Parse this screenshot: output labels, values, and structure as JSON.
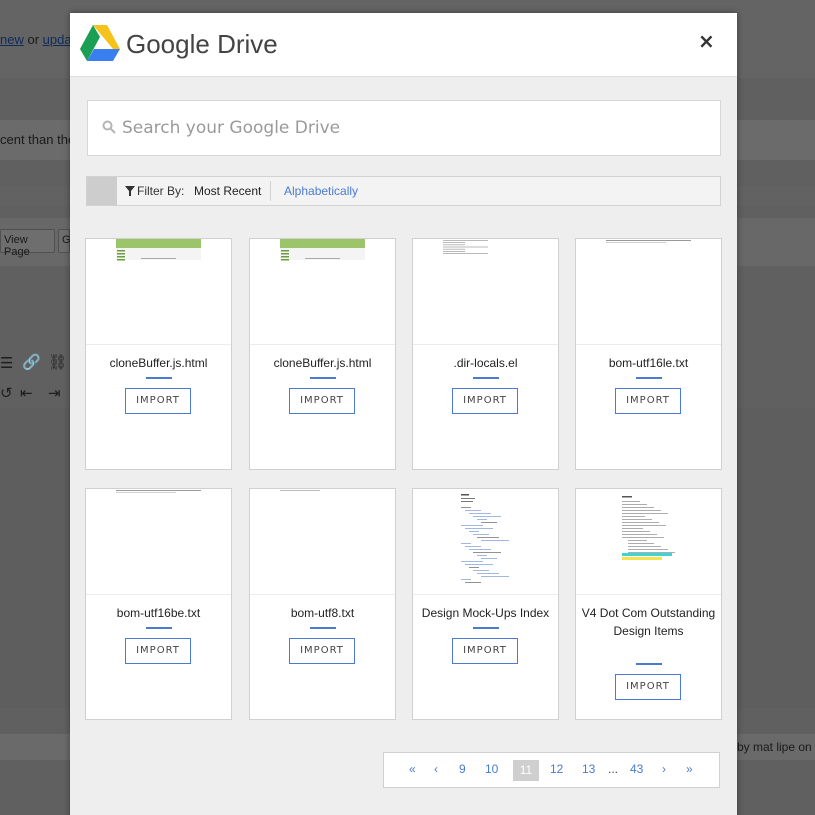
{
  "background": {
    "top_text_links": [
      "new",
      "updat"
    ],
    "top_text_or": "or",
    "recent_text": "cent than the",
    "view_page_btn": "View Page",
    "g_btn": "G",
    "bottom_text": "by mat lipe on Ja"
  },
  "modal": {
    "title": "Google Drive",
    "close_label": "×",
    "search": {
      "placeholder": "Search your Google Drive",
      "value": ""
    },
    "filter": {
      "label": "Filter By:",
      "options": [
        "Most Recent",
        "Alphabetically"
      ],
      "selected": "Most Recent"
    },
    "import_label": "IMPORT",
    "files": [
      {
        "name": "cloneBuffer.js.html",
        "thumb": "webpage"
      },
      {
        "name": "cloneBuffer.js.html",
        "thumb": "webpage"
      },
      {
        "name": ".dir-locals.el",
        "thumb": "text"
      },
      {
        "name": "bom-utf16le.txt",
        "thumb": "textline"
      },
      {
        "name": "bom-utf16be.txt",
        "thumb": "textline"
      },
      {
        "name": "bom-utf8.txt",
        "thumb": "textline-small"
      },
      {
        "name": "Design Mock-Ups Index",
        "thumb": "outline"
      },
      {
        "name": "V4 Dot Com Outstanding Design Items",
        "thumb": "doc-highlight"
      }
    ],
    "pagination": {
      "first": "«",
      "prev": "‹",
      "pages_before": [
        "9",
        "10"
      ],
      "current": "11",
      "pages_after": [
        "12",
        "13"
      ],
      "ellipsis": "...",
      "last_page": "43",
      "next": "›",
      "last": "»"
    }
  },
  "colors": {
    "accent": "#4a7bd0",
    "overlay": "#606060",
    "modal_bg": "#eeeeee"
  }
}
